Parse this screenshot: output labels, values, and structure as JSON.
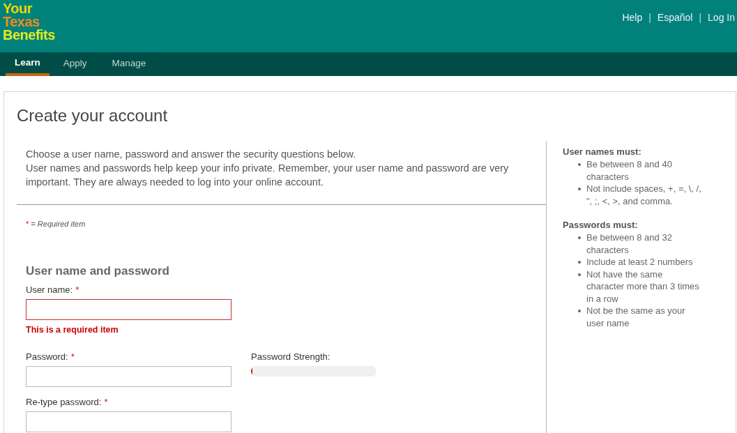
{
  "header": {
    "logo": [
      {
        "text": "Your",
        "color": "#f5d400"
      },
      {
        "text": "Texas",
        "color": "#f28b20"
      },
      {
        "text": "Benefits",
        "color": "#e6ea1e"
      }
    ],
    "links": [
      "Help",
      "Español",
      "Log In"
    ],
    "separator": "|"
  },
  "nav": [
    {
      "label": "Learn",
      "selected": true
    },
    {
      "label": "Apply",
      "selected": false
    },
    {
      "label": "Manage",
      "selected": false
    }
  ],
  "page": {
    "title": "Create your account",
    "intro": [
      "Choose a user name, password and answer the security questions below.",
      "User names and passwords help keep your info private. Remember, your user name and password are very important. They are always needed to log into your online account."
    ],
    "required_note": {
      "mark": "*",
      "text": "= Required item"
    },
    "section": "User name and password",
    "fields": [
      {
        "kind": "input",
        "label": "User name:",
        "required": true,
        "invalid": true,
        "error": "This is a required item"
      },
      {
        "kind": "password",
        "label": "Password:",
        "required": true,
        "invalid": false,
        "strength": {
          "label": "Password Strength:",
          "level": 0.01
        }
      },
      {
        "kind": "input",
        "label": "Re-type password:",
        "required": true,
        "invalid": false
      }
    ]
  },
  "sidebar": [
    {
      "title": "User names must:",
      "items": [
        "Be between 8 and 40 characters",
        "Not include spaces, +, =, \\, /, \", ;, <, >, and comma."
      ]
    },
    {
      "title": "Passwords must:",
      "items": [
        "Be between 8 and 32 characters",
        "Include at least 2 numbers",
        "Not have the same character more than 3 times in a row",
        "Not be the same as your user name"
      ]
    }
  ]
}
